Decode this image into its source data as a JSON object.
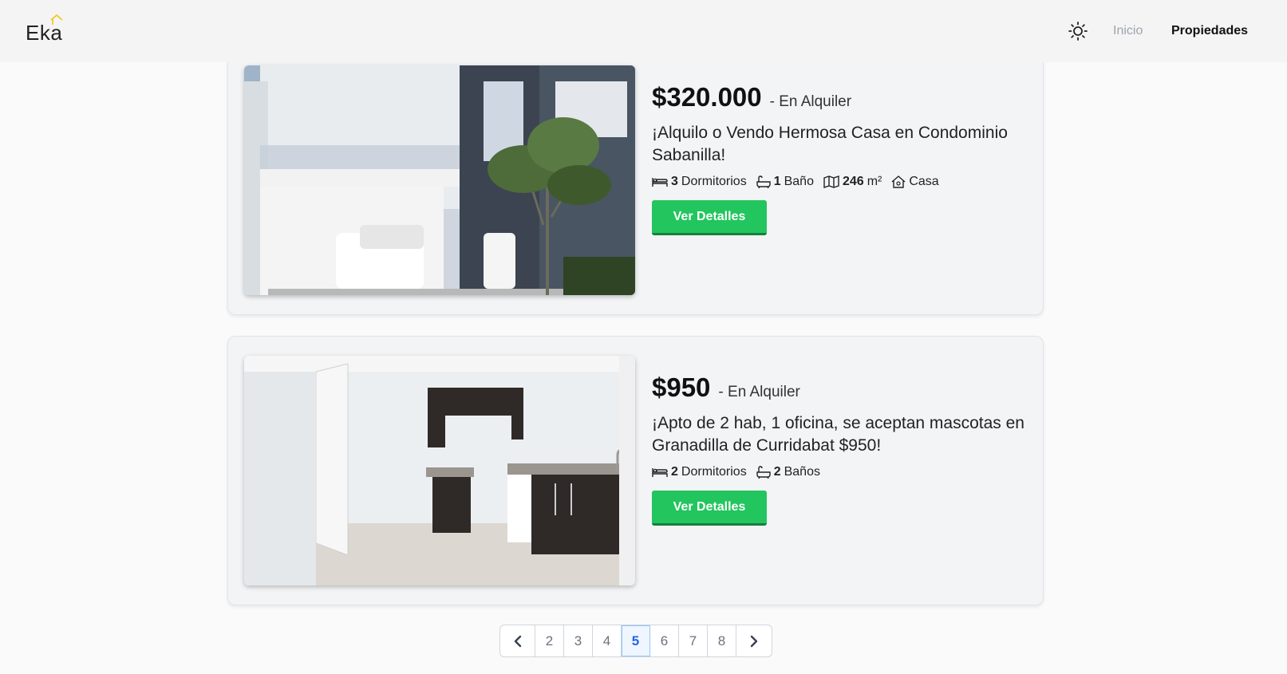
{
  "header": {
    "logo_text": "Eka",
    "logo_accent_color": "#f5c518",
    "theme_icon": "sun-icon",
    "nav": [
      {
        "label": "Inicio"
      },
      {
        "label": "Propiedades"
      }
    ]
  },
  "listings": [
    {
      "price": "$320.000",
      "status": "- En Alquiler",
      "title": "¡Alquilo o Vendo Hermosa Casa en Condominio Sabanilla!",
      "bedrooms": {
        "count": "3",
        "label": "Dormitorios"
      },
      "bathrooms": {
        "count": "1",
        "label": "Baño"
      },
      "area": {
        "value": "246",
        "unit": "m²"
      },
      "type": "Casa",
      "button_label": "Ver Detalles"
    },
    {
      "price": "$950",
      "status": "- En Alquiler",
      "title": "¡Apto de 2 hab, 1 oficina, se aceptan mascotas en Granadilla de Curridabat $950!",
      "bedrooms": {
        "count": "2",
        "label": "Dormitorios"
      },
      "bathrooms": {
        "count": "2",
        "label": "Baños"
      },
      "button_label": "Ver Detalles"
    }
  ],
  "pagination": {
    "prev_icon": "chevron-left-icon",
    "pages": [
      "2",
      "3",
      "4",
      "5",
      "6",
      "7",
      "8"
    ],
    "current": "5",
    "next_icon": "chevron-right-icon"
  },
  "colors": {
    "button_green": "#22c55e",
    "active_page_blue": "#2563eb"
  }
}
